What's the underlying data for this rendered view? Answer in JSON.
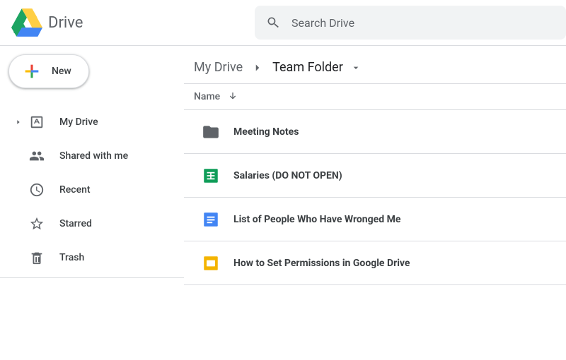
{
  "header": {
    "app_name": "Drive",
    "search_placeholder": "Search Drive"
  },
  "sidebar": {
    "new_label": "New",
    "items": [
      {
        "label": "My Drive",
        "icon": "drive-box-icon",
        "expandable": true
      },
      {
        "label": "Shared with me",
        "icon": "people-icon",
        "expandable": false
      },
      {
        "label": "Recent",
        "icon": "clock-icon",
        "expandable": false
      },
      {
        "label": "Starred",
        "icon": "star-icon",
        "expandable": false
      },
      {
        "label": "Trash",
        "icon": "trash-icon",
        "expandable": false
      }
    ]
  },
  "breadcrumb": {
    "parts": [
      "My Drive",
      "Team Folder"
    ]
  },
  "list_header": {
    "name_col": "Name"
  },
  "files": [
    {
      "name": "Meeting Notes",
      "type": "folder"
    },
    {
      "name": "Salaries (DO NOT OPEN)",
      "type": "sheets"
    },
    {
      "name": "List of People Who Have Wronged Me",
      "type": "docs"
    },
    {
      "name": "How to Set Permissions in Google Drive",
      "type": "slides"
    }
  ],
  "colors": {
    "folder": "#5f6368",
    "sheets": "#0f9d58",
    "docs": "#4285f4",
    "slides_border": "#f4b400"
  }
}
